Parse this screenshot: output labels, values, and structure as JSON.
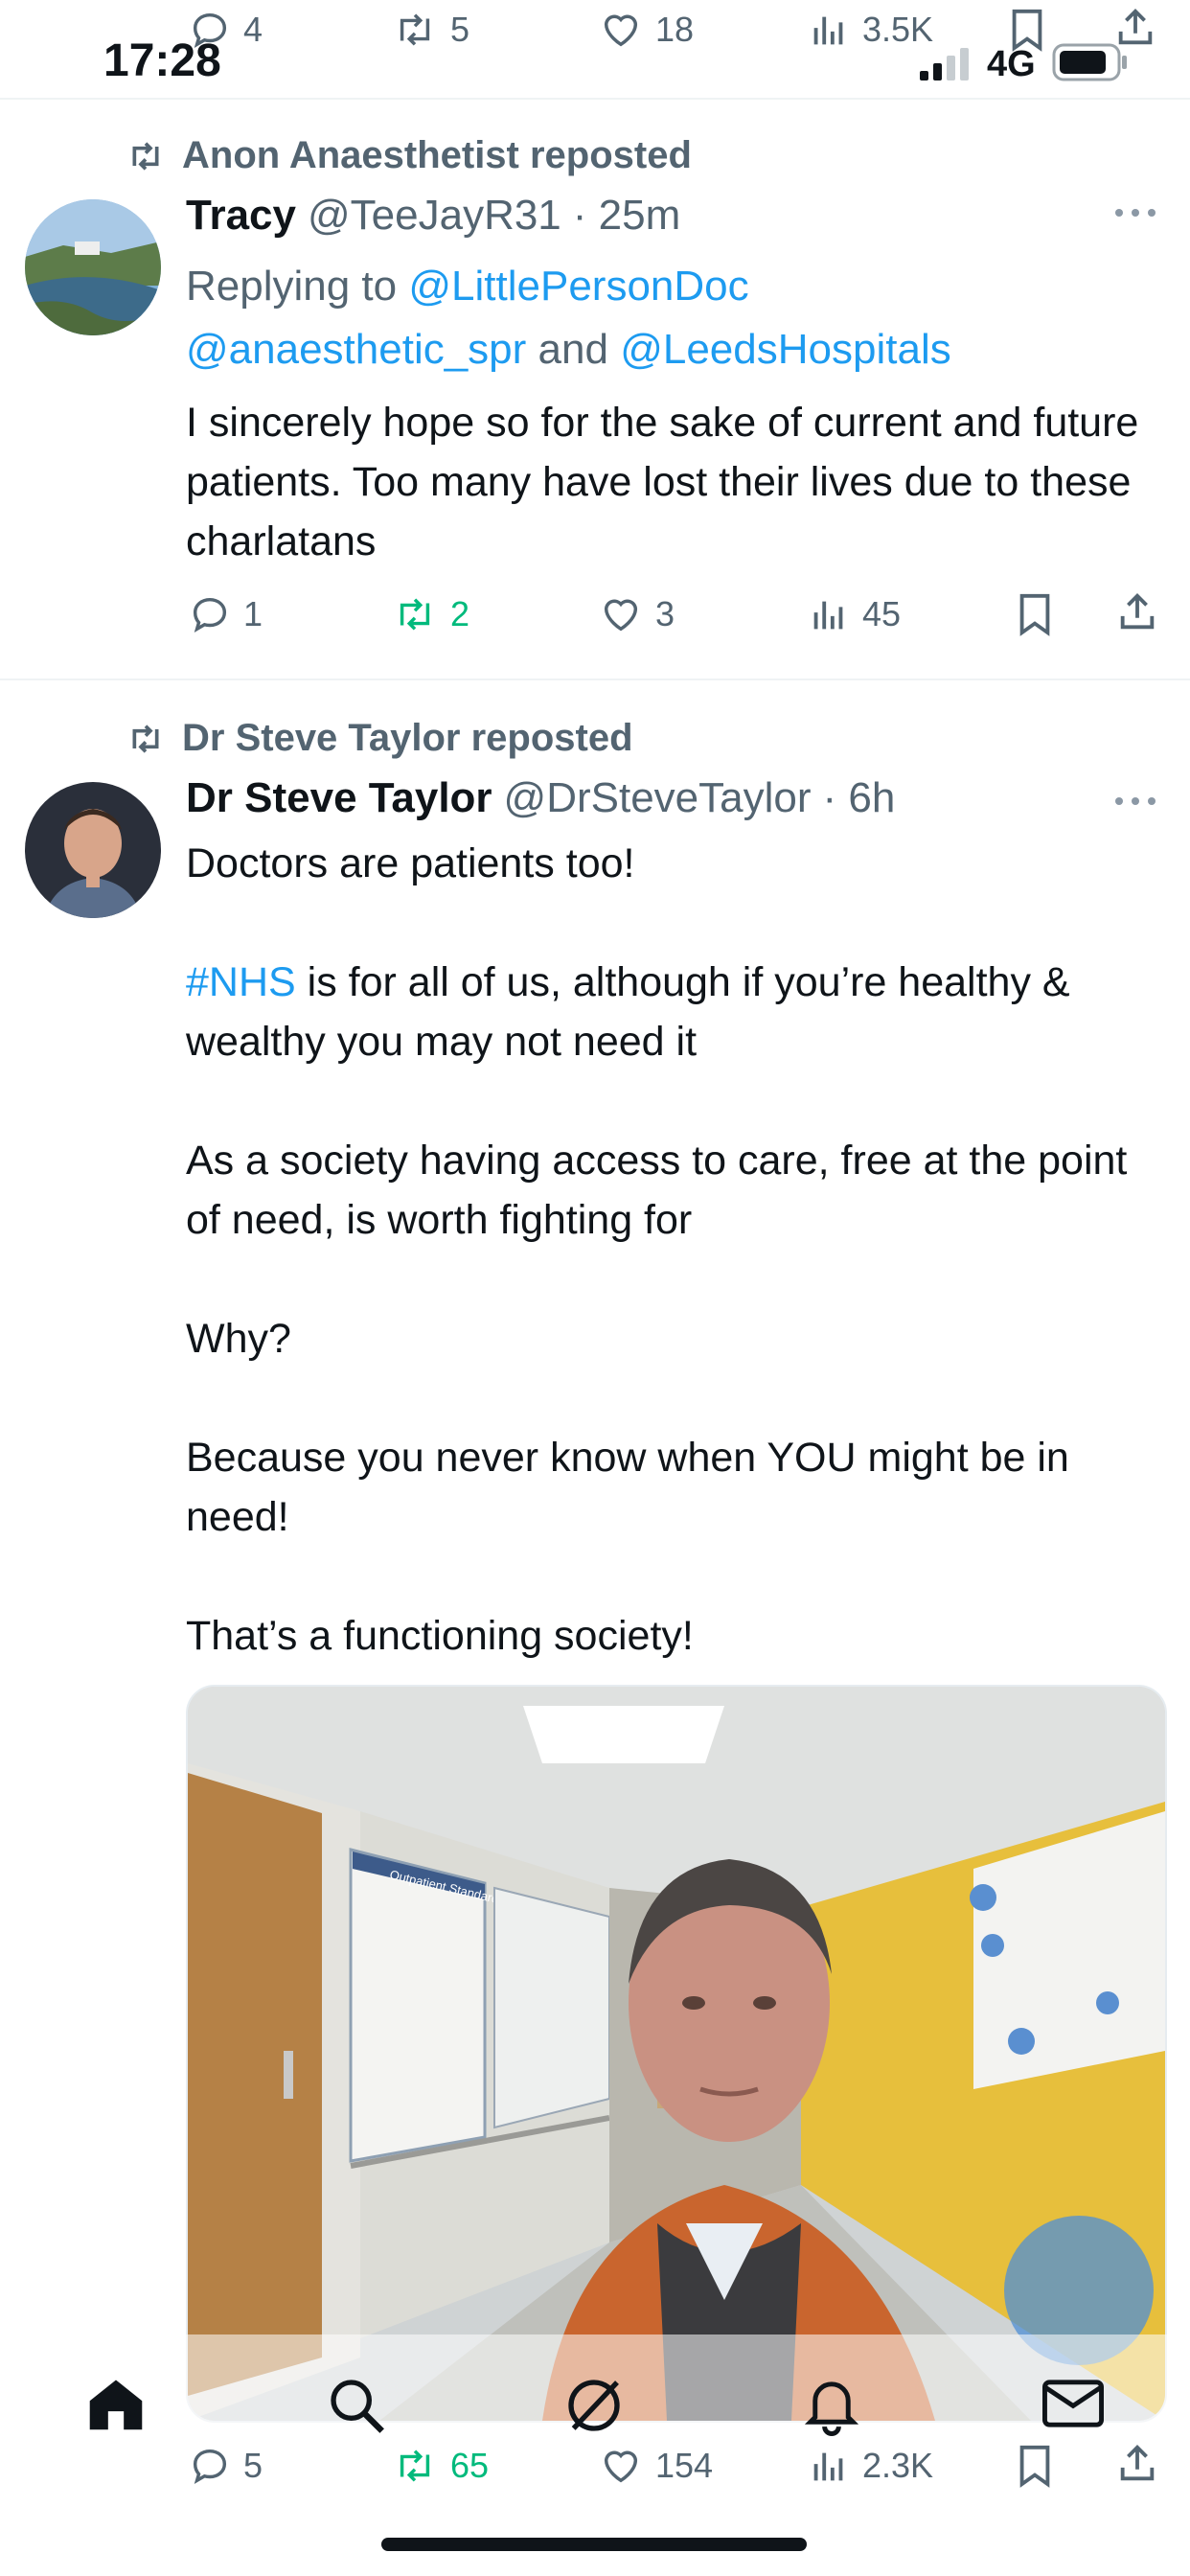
{
  "status_bar": {
    "time": "17:28",
    "network": "4G"
  },
  "top_partial_stats": {
    "replies": "4",
    "reposts": "5",
    "likes": "18",
    "views": "3.5K"
  },
  "tweets": [
    {
      "reposted_by": "Anon Anaesthetist reposted",
      "name": "Tracy",
      "handle": "@TeeJayR31",
      "time": "· 25m",
      "replying_label": "Replying to",
      "reply_to_1": "@LittlePersonDoc",
      "reply_to_2": "@anaesthetic_spr",
      "and_label": "and",
      "reply_to_3": "@LeedsHospitals",
      "text": "I sincerely hope so for the sake of current and future patients. Too many have lost their lives due to these charlatans",
      "stats": {
        "replies": "1",
        "reposts": "2",
        "likes": "3",
        "views": "45"
      }
    },
    {
      "reposted_by": "Dr Steve Taylor reposted",
      "name": "Dr Steve Taylor",
      "handle": "@DrSteveTaylor",
      "time": "· 6h",
      "line1": "Doctors are patients too!",
      "hashtag": "#NHS",
      "line2_rest": " is for all of us, although if you’re healthy & wealthy you may not need it",
      "line3": "As a society having access to care, free at the point of need, is worth fighting for",
      "line4": "Why?",
      "line5": "Because you never know when YOU might be in need!",
      "line6": "That’s a functioning society!",
      "image_sign_text": "Outpatient Standards",
      "stats": {
        "replies": "5",
        "reposts": "65",
        "likes": "154",
        "views": "2.3K"
      }
    }
  ],
  "colors": {
    "accent": "#1d9bf0",
    "repost_green": "#00ba7c",
    "muted": "#536471"
  }
}
